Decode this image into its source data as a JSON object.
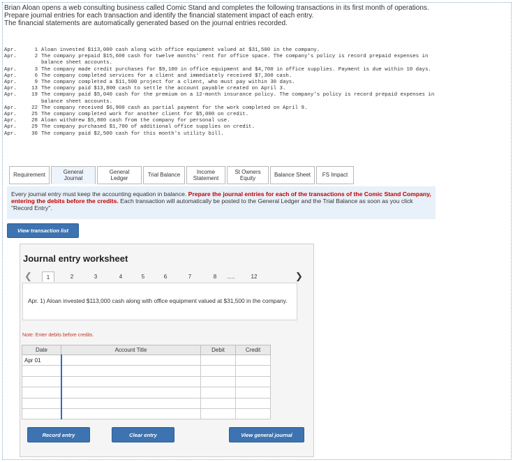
{
  "intro": {
    "line1": "Brian Aloan opens a web consulting business called Comic Stand and completes the following transactions in its first month of operations.",
    "line2": "Prepare journal entries for each transaction and identify the financial statement impact of each entry.",
    "line3": "The financial statements are automatically generated based on the journal entries recorded."
  },
  "transactions": [
    {
      "date": "Apr.",
      "num": "1",
      "text": "Aloan invested $113,000 cash along with office equipment valued at $31,500 in the company."
    },
    {
      "date": "Apr.",
      "num": "2",
      "text": "The company prepaid $15,600 cash for twelve months' rent for office space. The company's policy is record prepaid expenses in balance sheet accounts."
    },
    {
      "date": "Apr.",
      "num": "3",
      "text": "The company made credit purchases for $9,100 in office equipment and $4,700 in office supplies. Payment is due within 10 days."
    },
    {
      "date": "Apr.",
      "num": "6",
      "text": "The company completed services for a client and immediately received $7,300 cash."
    },
    {
      "date": "Apr.",
      "num": "9",
      "text": "The company completed a $11,500 project for a client, who must pay within 30 days."
    },
    {
      "date": "Apr.",
      "num": "13",
      "text": "The company paid $13,800 cash to settle the account payable created on April 3."
    },
    {
      "date": "Apr.",
      "num": "19",
      "text": "The company paid $5,040 cash for the premium on a 12-month insurance policy. The company's policy is record prepaid expenses in balance sheet accounts."
    },
    {
      "date": "Apr.",
      "num": "22",
      "text": "The company received $6,900 cash as partial payment for the work completed on April 9."
    },
    {
      "date": "Apr.",
      "num": "25",
      "text": "The company completed work for another client for $5,000 on credit."
    },
    {
      "date": "Apr.",
      "num": "28",
      "text": "Aloan withdrew $5,800 cash from the company for personal use."
    },
    {
      "date": "Apr.",
      "num": "29",
      "text": "The company purchased $1,700 of additional office supplies on credit."
    },
    {
      "date": "Apr.",
      "num": "30",
      "text": "The company paid $2,500 cash for this month's utility bill."
    }
  ],
  "tabs": [
    {
      "l1": "Requirement",
      "l2": ""
    },
    {
      "l1": "General",
      "l2": "Journal"
    },
    {
      "l1": "General",
      "l2": "Ledger"
    },
    {
      "l1": "Trial Balance",
      "l2": ""
    },
    {
      "l1": "Income",
      "l2": "Statement"
    },
    {
      "l1": "St Owners",
      "l2": "Equity"
    },
    {
      "l1": "Balance Sheet",
      "l2": ""
    },
    {
      "l1": "FS Impact",
      "l2": ""
    }
  ],
  "notice": {
    "plain1": "Every journal entry must keep the accounting equation in balance. ",
    "red": "Prepare the journal entries for each of the transactions of the Comic Stand Company, entering the debits before the credits.",
    "plain2": " Each transaction will automatically be posted to the General Ledger and the Trial Balance as soon as you click \"Record Entry\"."
  },
  "view_tx_label": "View transaction list",
  "worksheet": {
    "title": "Journal entry worksheet",
    "pages": [
      "1",
      "2",
      "3",
      "4",
      "5",
      "6",
      "7",
      "8",
      ".....",
      "12"
    ],
    "transaction_text": "Apr. 1) Aloan invested $113,000 cash along with office equipment valued at $31,500 in the company.",
    "note": "Note: Enter debits before credits.",
    "columns": {
      "date": "Date",
      "account": "Account Title",
      "debit": "Debit",
      "credit": "Credit"
    },
    "rows": [
      {
        "date": "Apr 01"
      },
      {
        "date": ""
      },
      {
        "date": ""
      },
      {
        "date": ""
      },
      {
        "date": ""
      },
      {
        "date": ""
      }
    ],
    "buttons": {
      "record": "Record entry",
      "clear": "Clear entry",
      "view_gj": "View general journal"
    }
  },
  "colors": {
    "accent": "#3c73b0",
    "notice_bg": "#e8f0f9",
    "instruction_red": "#c00000"
  }
}
